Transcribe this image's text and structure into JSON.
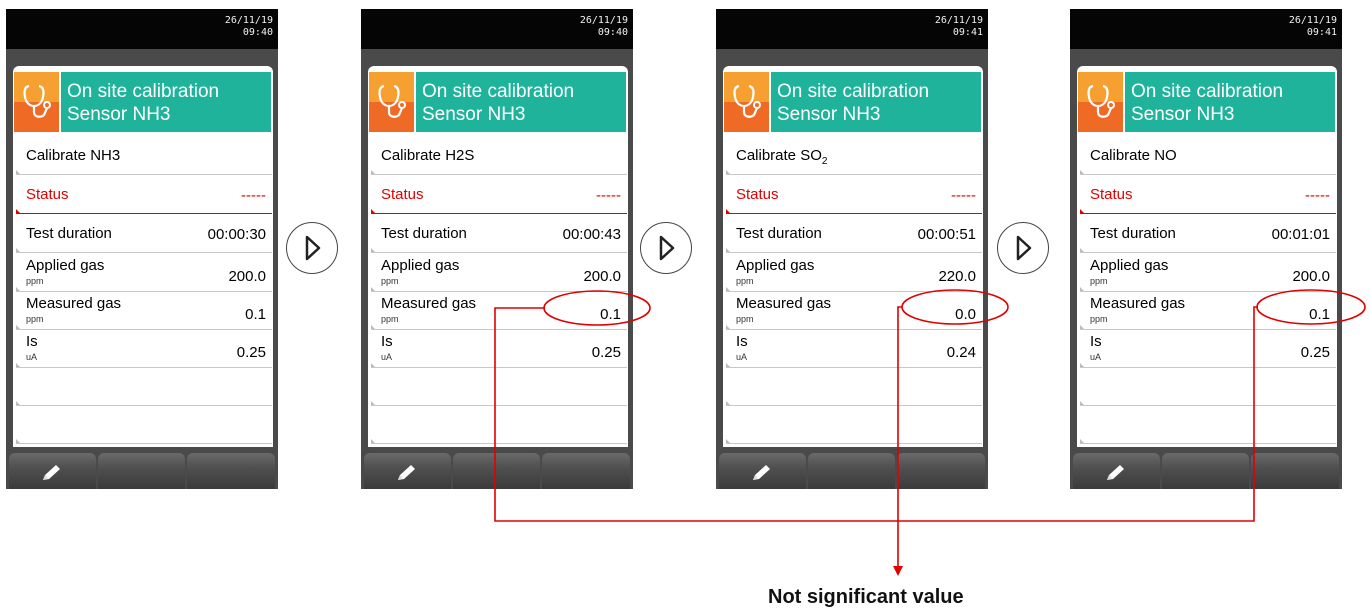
{
  "devices": [
    {
      "date": "26/11/19",
      "time": "09:40",
      "title_line1": "On site calibration",
      "title_line2": "Sensor NH3",
      "calibrate": "Calibrate NH3",
      "status_label": "Status",
      "status_value": "-----",
      "test_duration_label": "Test duration",
      "test_duration": "00:00:30",
      "applied_label": "Applied gas",
      "applied_unit": "ppm",
      "applied_value": "200.0",
      "measured_label": "Measured gas",
      "measured_unit": "ppm",
      "measured_value": "0.1",
      "is_label": "Is",
      "is_unit": "uA",
      "is_value": "0.25"
    },
    {
      "date": "26/11/19",
      "time": "09:40",
      "title_line1": "On site calibration",
      "title_line2": "Sensor NH3",
      "calibrate": "Calibrate H2S",
      "status_label": "Status",
      "status_value": "-----",
      "test_duration_label": "Test duration",
      "test_duration": "00:00:43",
      "applied_label": "Applied gas",
      "applied_unit": "ppm",
      "applied_value": "200.0",
      "measured_label": "Measured gas",
      "measured_unit": "ppm",
      "measured_value": "0.1",
      "is_label": "Is",
      "is_unit": "uA",
      "is_value": "0.25"
    },
    {
      "date": "26/11/19",
      "time": "09:41",
      "title_line1": "On site calibration",
      "title_line2": "Sensor NH3",
      "calibrate": "Calibrate SO",
      "calibrate_sub": "2",
      "status_label": "Status",
      "status_value": "-----",
      "test_duration_label": "Test duration",
      "test_duration": "00:00:51",
      "applied_label": "Applied gas",
      "applied_unit": "ppm",
      "applied_value": "220.0",
      "measured_label": "Measured gas",
      "measured_unit": "ppm",
      "measured_value": "0.0",
      "is_label": "Is",
      "is_unit": "uA",
      "is_value": "0.24"
    },
    {
      "date": "26/11/19",
      "time": "09:41",
      "title_line1": "On site calibration",
      "title_line2": "Sensor NH3",
      "calibrate": "Calibrate NO",
      "status_label": "Status",
      "status_value": "-----",
      "test_duration_label": "Test duration",
      "test_duration": "00:01:01",
      "applied_label": "Applied gas",
      "applied_unit": "ppm",
      "applied_value": "200.0",
      "measured_label": "Measured gas",
      "measured_unit": "ppm",
      "measured_value": "0.1",
      "is_label": "Is",
      "is_unit": "uA",
      "is_value": "0.25"
    }
  ],
  "icons": {
    "header": "stethoscope-icon",
    "footer": "pencil-icon",
    "next": "play-arrow-icon"
  },
  "colors": {
    "header_icon_bg": "#ef6b25",
    "header_icon_badge": "#f6a031",
    "header_title_bg": "#20b39c",
    "status_red": "#e00000",
    "highlight_red": "#e00000"
  },
  "annotation": {
    "note": "Not significant value"
  }
}
